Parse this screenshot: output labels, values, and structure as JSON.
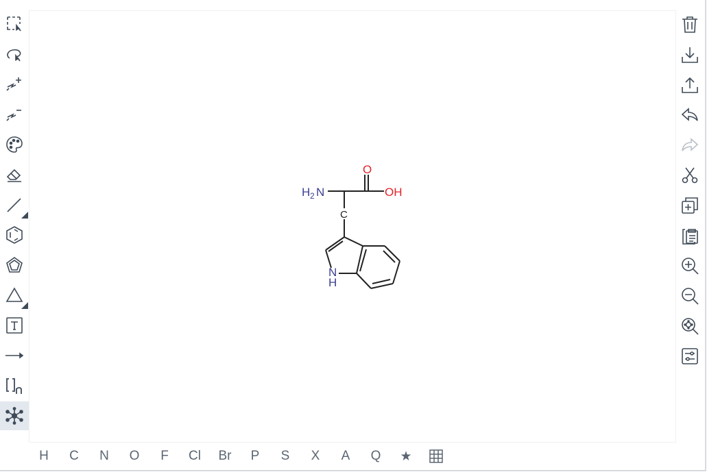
{
  "app": {
    "name": "Ketcher structure editor"
  },
  "colors": {
    "icon": "#3f4a57",
    "icon_disabled": "#b8bfc7",
    "atom_button": "#5c6673",
    "bond": "#222222",
    "nitrogen": "#3b3f8f",
    "oxygen": "#e0242a",
    "carbon": "#222222",
    "active_tool_bg": "#e3e8ee"
  },
  "left_toolbar": [
    {
      "name": "rectangle-selection-icon",
      "title": "Rectangle selection"
    },
    {
      "name": "lasso-selection-icon",
      "title": "Lasso selection"
    },
    {
      "name": "charge-plus-icon",
      "title": "Charge plus"
    },
    {
      "name": "charge-minus-icon",
      "title": "Charge minus"
    },
    {
      "name": "palette-icon",
      "title": "Color"
    },
    {
      "name": "eraser-icon",
      "title": "Erase"
    },
    {
      "name": "single-bond-icon",
      "title": "Single bond"
    },
    {
      "name": "benzene-icon",
      "title": "Benzene"
    },
    {
      "name": "cyclopentane-icon",
      "title": "Cyclopentane"
    },
    {
      "name": "triangle-shape-icon",
      "title": "Shape"
    },
    {
      "name": "text-icon",
      "title": "Add text"
    },
    {
      "name": "arrow-icon",
      "title": "Reaction arrow"
    },
    {
      "name": "sgroup-bracket-icon",
      "title": "S-Group"
    },
    {
      "name": "network-icon",
      "title": "Template",
      "active": true
    }
  ],
  "right_toolbar": [
    {
      "name": "trash-icon",
      "title": "Clear canvas"
    },
    {
      "name": "download-icon",
      "title": "Save"
    },
    {
      "name": "upload-icon",
      "title": "Open"
    },
    {
      "name": "undo-icon",
      "title": "Undo"
    },
    {
      "name": "redo-icon",
      "title": "Redo",
      "disabled": true
    },
    {
      "name": "scissors-icon",
      "title": "Cut"
    },
    {
      "name": "copy-icon",
      "title": "Copy"
    },
    {
      "name": "paste-icon",
      "title": "Paste"
    },
    {
      "name": "zoom-in-icon",
      "title": "Zoom in"
    },
    {
      "name": "zoom-out-icon",
      "title": "Zoom out"
    },
    {
      "name": "zoom-fit-icon",
      "title": "Zoom to fit"
    },
    {
      "name": "settings-sliders-icon",
      "title": "Settings"
    }
  ],
  "atoms": [
    "H",
    "C",
    "N",
    "O",
    "F",
    "Cl",
    "Br",
    "P",
    "S",
    "X",
    "A",
    "Q",
    "★"
  ],
  "periodic_table_icon": "grid-icon",
  "molecule": {
    "h2n_H": "H",
    "h2n_sub": "2",
    "h2n_N": "N",
    "carbonyl_o": "O",
    "hydroxyl": "OH",
    "carbon": "C",
    "ring_n": "N",
    "ring_h": "H"
  }
}
